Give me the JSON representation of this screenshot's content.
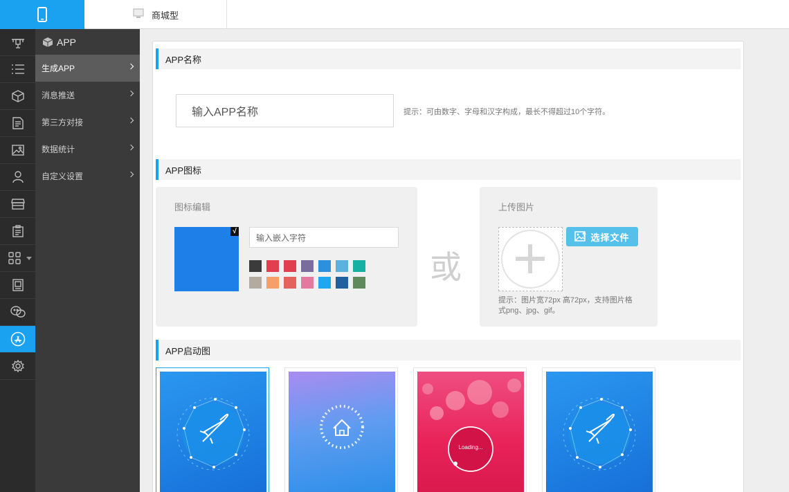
{
  "topbar": {
    "brand_icon": "mobile-phone-icon",
    "tab_label": "商城型",
    "tab_icon": "monitor-icon"
  },
  "rail": {
    "items": [
      {
        "icon": "drone-icon"
      },
      {
        "icon": "list-icon"
      },
      {
        "icon": "cube-icon"
      },
      {
        "icon": "document-icon"
      },
      {
        "icon": "image-icon"
      },
      {
        "icon": "user-icon"
      },
      {
        "icon": "store-icon"
      },
      {
        "icon": "clipboard-icon"
      },
      {
        "icon": "grid-icon"
      },
      {
        "icon": "picture-frame-icon"
      },
      {
        "icon": "wechat-icon"
      },
      {
        "icon": "app-store-icon",
        "active": true
      },
      {
        "icon": "gear-icon"
      }
    ]
  },
  "submenu": {
    "title": "APP",
    "items": [
      {
        "label": "生成APP",
        "active": true
      },
      {
        "label": "消息推送"
      },
      {
        "label": "第三方对接"
      },
      {
        "label": "数据统计"
      },
      {
        "label": "自定义设置"
      }
    ]
  },
  "app_name": {
    "section_title": "APP名称",
    "placeholder": "输入APP名称",
    "hint": "提示：可由数字、字母和汉字构成，最长不得超过10个字符。"
  },
  "app_icon": {
    "section_title": "APP图标",
    "editor_title": "图标编辑",
    "check_mark": "√",
    "embed_placeholder": "输入嵌入字符",
    "colors": [
      "#3b3b3b",
      "#e0404d",
      "#e0404d",
      "#7a6c9c",
      "#2b90dd",
      "#5ab3de",
      "#16b0a4",
      "#b3aba0",
      "#f4a06a",
      "#e4625d",
      "#e27aa0",
      "#1ea8f0",
      "#2060a0",
      "#5f8a5e"
    ],
    "or_text": "或",
    "upload_title": "上传图片",
    "choose_button": "选择文件",
    "upload_hint": "提示：图片宽72px 高72px，支持图片格式png、jpg、gif。"
  },
  "splash": {
    "section_title": "APP启动图",
    "loading_text": "Loading..."
  },
  "colors": {
    "accent": "#1aa1f0",
    "rail_bg": "#2b2b2b",
    "submenu_bg": "#3a3a3a"
  }
}
